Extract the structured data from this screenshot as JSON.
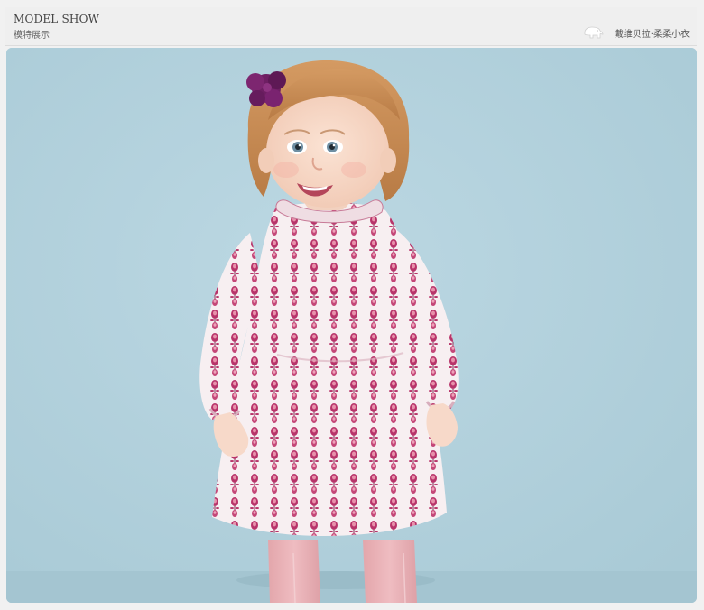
{
  "header": {
    "title_en": "MODEL SHOW",
    "title_cn": "模特展示",
    "brand_text": "戴维贝拉·柔柔小衣",
    "brand_icon": "elephant-icon"
  },
  "photo": {
    "subject": "toddler-model-photo",
    "colors": {
      "background": "#b2d1dd",
      "floor": "#a6c7d3",
      "dress_base": "#f6eef0",
      "dress_print": "#b8346a",
      "hair": "#c98a52",
      "flower_clip": "#6e1f63",
      "tights": "#e7b1b6",
      "skin": "#f6d8c7"
    }
  }
}
